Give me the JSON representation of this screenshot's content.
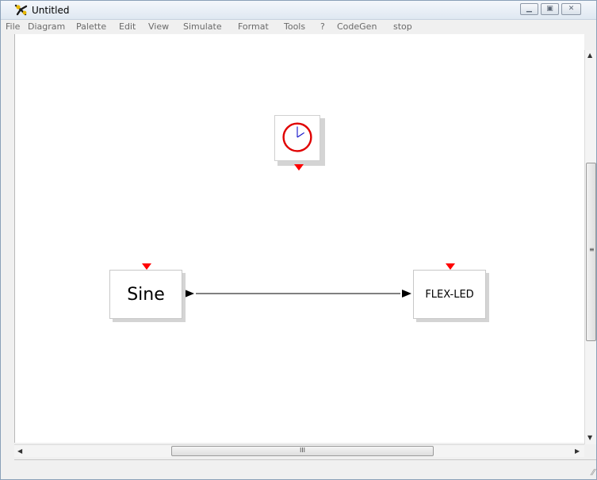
{
  "window": {
    "title": "Untitled"
  },
  "menu": {
    "items": [
      "File",
      "Diagram",
      "Palette",
      "Edit",
      "View",
      "Simulate",
      "Format",
      "Tools",
      "?",
      "CodeGen",
      "stop"
    ]
  },
  "blocks": {
    "clock": {
      "name": "clock"
    },
    "sine": {
      "label": "Sine"
    },
    "flexled": {
      "label": "FLEX-LED"
    }
  },
  "scrollbars": {
    "h_grip": "III",
    "v_grip": "≡"
  },
  "colors": {
    "port": "#ff0000",
    "clock_ring": "#e00000",
    "clock_hand": "#1c1ccc",
    "link": "#000000"
  }
}
